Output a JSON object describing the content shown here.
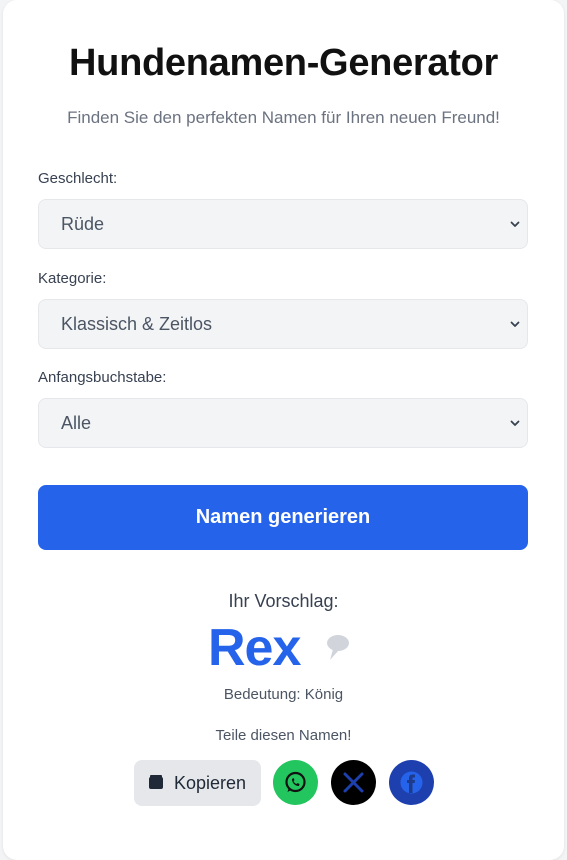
{
  "title": "Hundenamen-Generator",
  "subtitle": "Finden Sie den perfekten Namen für Ihren neuen Freund!",
  "form": {
    "gender": {
      "label": "Geschlecht:",
      "value": "Rüde"
    },
    "category": {
      "label": "Kategorie:",
      "value": "Klassisch & Zeitlos"
    },
    "letter": {
      "label": "Anfangsbuchstabe:",
      "value": "Alle"
    }
  },
  "generate_button": "Namen generieren",
  "result": {
    "label": "Ihr Vorschlag:",
    "name": "Rex",
    "meaning": "Bedeutung: König"
  },
  "share": {
    "label": "Teile diesen Namen!",
    "copy_label": "Kopieren"
  },
  "colors": {
    "primary": "#2563eb",
    "whatsapp": "#22c55e",
    "x": "#000000",
    "facebook": "#1e40af"
  },
  "icons": [
    "chevron-down-icon",
    "speech-bubble-icon",
    "clipboard-icon",
    "whatsapp-icon",
    "x-icon",
    "facebook-icon"
  ]
}
